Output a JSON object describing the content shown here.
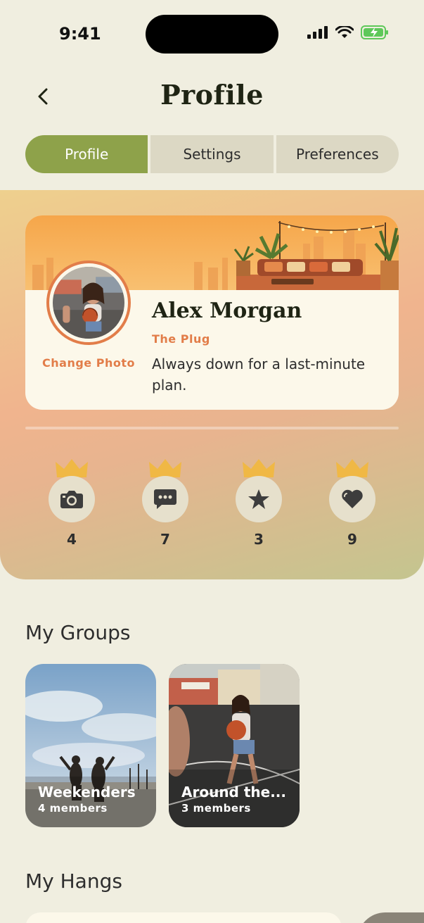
{
  "status_bar": {
    "time": "9:41"
  },
  "header": {
    "title": "Profile"
  },
  "tabs": [
    {
      "label": "Profile",
      "active": true
    },
    {
      "label": "Settings",
      "active": false
    },
    {
      "label": "Preferences",
      "active": false
    }
  ],
  "profile": {
    "name": "Alex Morgan",
    "tagline": "The Plug",
    "bio": "Always down for a last-minute plan.",
    "change_photo_label": "Change Photo"
  },
  "badges": [
    {
      "icon": "camera-icon",
      "count": "4"
    },
    {
      "icon": "chat-icon",
      "count": "7"
    },
    {
      "icon": "star-icon",
      "count": "3"
    },
    {
      "icon": "heart-icon",
      "count": "9"
    }
  ],
  "groups_section": {
    "title": "My Groups",
    "groups": [
      {
        "name": "Weekenders",
        "members": "4 members"
      },
      {
        "name": "Around the...",
        "members": "3 members"
      }
    ]
  },
  "hangs_section": {
    "title": "My Hangs"
  },
  "colors": {
    "accent_green": "#8ea24a",
    "accent_orange": "#e27d49",
    "crown_gold": "#f0b845"
  }
}
